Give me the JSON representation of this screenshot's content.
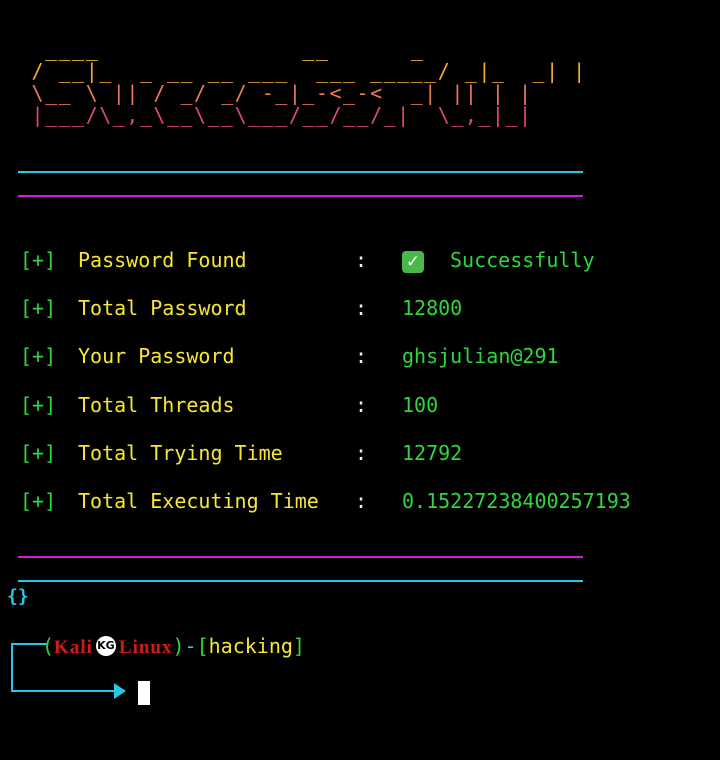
{
  "banner": {
    "lines": [
      "  ____               __      _",
      " / __|_  _ __ __ ___  ___ _____/ _|_  _| |",
      " \\__ \\ || / _/ _/ -_|_-<_-<  _| || | |",
      " |___/\\_,_\\__\\__\\___/__/__/_|  \\_,_|_|"
    ]
  },
  "results": [
    {
      "tag": "[+]",
      "label": "Password Found",
      "colon": ":",
      "value": "Successfully",
      "icon": "check-mark-icon"
    },
    {
      "tag": "[+]",
      "label": "Total Password",
      "colon": ":",
      "value": "12800"
    },
    {
      "tag": "[+]",
      "label": "Your Password",
      "colon": ":",
      "value": "ghsjulian@291"
    },
    {
      "tag": "[+]",
      "label": "Total Threads",
      "colon": ":",
      "value": "100"
    },
    {
      "tag": "[+]",
      "label": "Total Trying Time",
      "colon": ":",
      "value": "12792"
    },
    {
      "tag": "[+]",
      "label": "Total Executing Time",
      "colon": ":",
      "value": "0.15227238400257193"
    }
  ],
  "braces": "{}",
  "prompt": {
    "open_paren": "(",
    "host_part1": "Kali",
    "logo_text": "KG",
    "host_part2": "Linux",
    "close_paren": ")",
    "dash": "-",
    "open_bracket": "[",
    "directory": "hacking",
    "close_bracket": "]"
  },
  "colors": {
    "background": "#000000",
    "cyan": "#25c8e6",
    "magenta": "#d21ed2",
    "green": "#2fd63c",
    "yellow": "#f7e733",
    "red": "#d21a1a"
  }
}
